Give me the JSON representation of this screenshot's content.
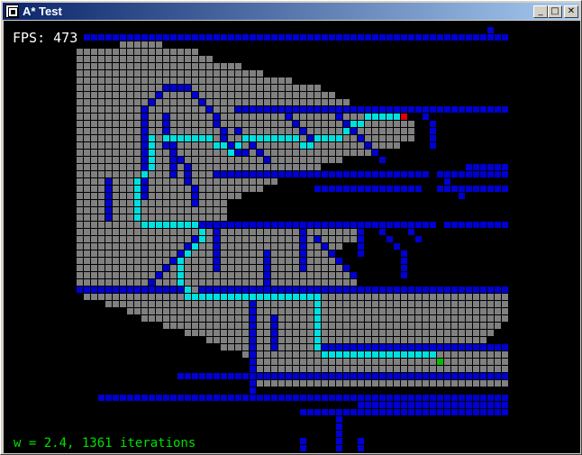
{
  "window": {
    "title": "A* Test",
    "minimize_glyph": "_",
    "maximize_glyph": "□",
    "close_glyph": "✕"
  },
  "overlay": {
    "fps_text": "FPS: 473",
    "status_text": "w = 2.4, 1361 iterations"
  },
  "colors": {
    "wall": "#0000d0",
    "explored": "#808080",
    "path": "#00e0e0",
    "start": "#00c000",
    "goal": "#e00000",
    "background": "#000000",
    "status_text": "#00e000"
  }
}
